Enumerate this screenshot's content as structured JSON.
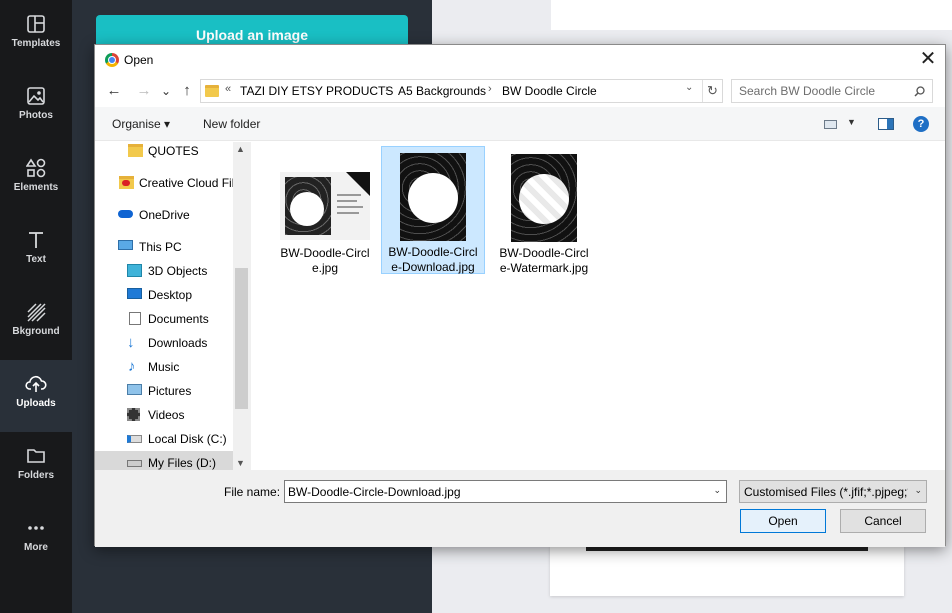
{
  "canva": {
    "rail": [
      {
        "label": "Templates",
        "icon": "templates-icon"
      },
      {
        "label": "Photos",
        "icon": "photos-icon"
      },
      {
        "label": "Elements",
        "icon": "elements-icon"
      },
      {
        "label": "Text",
        "icon": "text-icon"
      },
      {
        "label": "Bkground",
        "icon": "background-icon"
      },
      {
        "label": "Uploads",
        "icon": "uploads-icon",
        "active": true
      },
      {
        "label": "Folders",
        "icon": "folders-icon"
      },
      {
        "label": "More",
        "icon": "more-icon"
      }
    ],
    "upload_button": "Upload an image",
    "accent": "#19bfc4"
  },
  "dialog": {
    "title": "Open",
    "close_glyph": "✕",
    "nav": {
      "back": "←",
      "forward": "→",
      "recent": "⌄",
      "up": "↑"
    },
    "breadcrumb": {
      "overflow": "«",
      "items": [
        "TAZI DIY ETSY PRODUCTS",
        "A5 Backgrounds",
        "BW Doodle Circle"
      ],
      "separator": "›"
    },
    "search": {
      "placeholder": "Search BW Doodle Circle"
    },
    "toolbar": {
      "organise": "Organise ▾",
      "new_folder": "New folder",
      "help": "?"
    },
    "nav_pane": [
      {
        "label": "QUOTES",
        "icon": "folder-icon"
      },
      {
        "label": "Creative Cloud Fil",
        "icon": "creative-cloud-icon"
      },
      {
        "label": "OneDrive",
        "icon": "onedrive-icon"
      },
      {
        "label": "This PC",
        "icon": "this-pc-icon"
      },
      {
        "label": "3D Objects",
        "icon": "3d-objects-icon"
      },
      {
        "label": "Desktop",
        "icon": "desktop-icon"
      },
      {
        "label": "Documents",
        "icon": "documents-icon"
      },
      {
        "label": "Downloads",
        "icon": "downloads-icon"
      },
      {
        "label": "Music",
        "icon": "music-icon"
      },
      {
        "label": "Pictures",
        "icon": "pictures-icon"
      },
      {
        "label": "Videos",
        "icon": "videos-icon"
      },
      {
        "label": "Local Disk (C:)",
        "icon": "local-disk-icon"
      },
      {
        "label": "My Files (D:)",
        "icon": "drive-icon",
        "selected": true
      }
    ],
    "files": [
      {
        "line1": "BW-Doodle-Circl",
        "line2": "e.jpg",
        "type": "mockup"
      },
      {
        "line1": "BW-Doodle-Circl",
        "line2": "e-Download.jpg",
        "type": "doodle",
        "selected": true
      },
      {
        "line1": "BW-Doodle-Circl",
        "line2": "e-Watermark.jpg",
        "type": "watermark"
      }
    ],
    "file_name_label": "File name:",
    "file_name_value": "BW-Doodle-Circle-Download.jpg",
    "filter_value": "Customised Files (*.jfif;*.pjpeg;*",
    "open_label": "Open",
    "cancel_label": "Cancel",
    "dropdown_glyph": "⌄"
  }
}
